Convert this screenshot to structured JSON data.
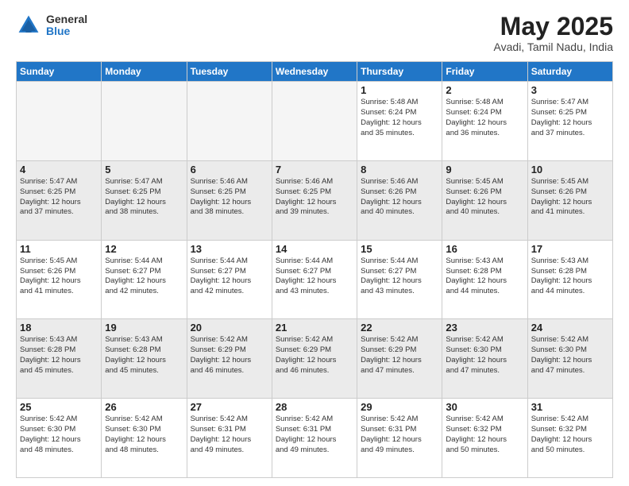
{
  "logo": {
    "general": "General",
    "blue": "Blue"
  },
  "title": "May 2025",
  "location": "Avadi, Tamil Nadu, India",
  "days_of_week": [
    "Sunday",
    "Monday",
    "Tuesday",
    "Wednesday",
    "Thursday",
    "Friday",
    "Saturday"
  ],
  "weeks": [
    [
      {
        "day": "",
        "info": "",
        "empty": true
      },
      {
        "day": "",
        "info": "",
        "empty": true
      },
      {
        "day": "",
        "info": "",
        "empty": true
      },
      {
        "day": "",
        "info": "",
        "empty": true
      },
      {
        "day": "1",
        "info": "Sunrise: 5:48 AM\nSunset: 6:24 PM\nDaylight: 12 hours\nand 35 minutes."
      },
      {
        "day": "2",
        "info": "Sunrise: 5:48 AM\nSunset: 6:24 PM\nDaylight: 12 hours\nand 36 minutes."
      },
      {
        "day": "3",
        "info": "Sunrise: 5:47 AM\nSunset: 6:25 PM\nDaylight: 12 hours\nand 37 minutes."
      }
    ],
    [
      {
        "day": "4",
        "info": "Sunrise: 5:47 AM\nSunset: 6:25 PM\nDaylight: 12 hours\nand 37 minutes."
      },
      {
        "day": "5",
        "info": "Sunrise: 5:47 AM\nSunset: 6:25 PM\nDaylight: 12 hours\nand 38 minutes."
      },
      {
        "day": "6",
        "info": "Sunrise: 5:46 AM\nSunset: 6:25 PM\nDaylight: 12 hours\nand 38 minutes."
      },
      {
        "day": "7",
        "info": "Sunrise: 5:46 AM\nSunset: 6:25 PM\nDaylight: 12 hours\nand 39 minutes."
      },
      {
        "day": "8",
        "info": "Sunrise: 5:46 AM\nSunset: 6:26 PM\nDaylight: 12 hours\nand 40 minutes."
      },
      {
        "day": "9",
        "info": "Sunrise: 5:45 AM\nSunset: 6:26 PM\nDaylight: 12 hours\nand 40 minutes."
      },
      {
        "day": "10",
        "info": "Sunrise: 5:45 AM\nSunset: 6:26 PM\nDaylight: 12 hours\nand 41 minutes."
      }
    ],
    [
      {
        "day": "11",
        "info": "Sunrise: 5:45 AM\nSunset: 6:26 PM\nDaylight: 12 hours\nand 41 minutes."
      },
      {
        "day": "12",
        "info": "Sunrise: 5:44 AM\nSunset: 6:27 PM\nDaylight: 12 hours\nand 42 minutes."
      },
      {
        "day": "13",
        "info": "Sunrise: 5:44 AM\nSunset: 6:27 PM\nDaylight: 12 hours\nand 42 minutes."
      },
      {
        "day": "14",
        "info": "Sunrise: 5:44 AM\nSunset: 6:27 PM\nDaylight: 12 hours\nand 43 minutes."
      },
      {
        "day": "15",
        "info": "Sunrise: 5:44 AM\nSunset: 6:27 PM\nDaylight: 12 hours\nand 43 minutes."
      },
      {
        "day": "16",
        "info": "Sunrise: 5:43 AM\nSunset: 6:28 PM\nDaylight: 12 hours\nand 44 minutes."
      },
      {
        "day": "17",
        "info": "Sunrise: 5:43 AM\nSunset: 6:28 PM\nDaylight: 12 hours\nand 44 minutes."
      }
    ],
    [
      {
        "day": "18",
        "info": "Sunrise: 5:43 AM\nSunset: 6:28 PM\nDaylight: 12 hours\nand 45 minutes."
      },
      {
        "day": "19",
        "info": "Sunrise: 5:43 AM\nSunset: 6:28 PM\nDaylight: 12 hours\nand 45 minutes."
      },
      {
        "day": "20",
        "info": "Sunrise: 5:42 AM\nSunset: 6:29 PM\nDaylight: 12 hours\nand 46 minutes."
      },
      {
        "day": "21",
        "info": "Sunrise: 5:42 AM\nSunset: 6:29 PM\nDaylight: 12 hours\nand 46 minutes."
      },
      {
        "day": "22",
        "info": "Sunrise: 5:42 AM\nSunset: 6:29 PM\nDaylight: 12 hours\nand 47 minutes."
      },
      {
        "day": "23",
        "info": "Sunrise: 5:42 AM\nSunset: 6:30 PM\nDaylight: 12 hours\nand 47 minutes."
      },
      {
        "day": "24",
        "info": "Sunrise: 5:42 AM\nSunset: 6:30 PM\nDaylight: 12 hours\nand 47 minutes."
      }
    ],
    [
      {
        "day": "25",
        "info": "Sunrise: 5:42 AM\nSunset: 6:30 PM\nDaylight: 12 hours\nand 48 minutes."
      },
      {
        "day": "26",
        "info": "Sunrise: 5:42 AM\nSunset: 6:30 PM\nDaylight: 12 hours\nand 48 minutes."
      },
      {
        "day": "27",
        "info": "Sunrise: 5:42 AM\nSunset: 6:31 PM\nDaylight: 12 hours\nand 49 minutes."
      },
      {
        "day": "28",
        "info": "Sunrise: 5:42 AM\nSunset: 6:31 PM\nDaylight: 12 hours\nand 49 minutes."
      },
      {
        "day": "29",
        "info": "Sunrise: 5:42 AM\nSunset: 6:31 PM\nDaylight: 12 hours\nand 49 minutes."
      },
      {
        "day": "30",
        "info": "Sunrise: 5:42 AM\nSunset: 6:32 PM\nDaylight: 12 hours\nand 50 minutes."
      },
      {
        "day": "31",
        "info": "Sunrise: 5:42 AM\nSunset: 6:32 PM\nDaylight: 12 hours\nand 50 minutes."
      }
    ]
  ]
}
